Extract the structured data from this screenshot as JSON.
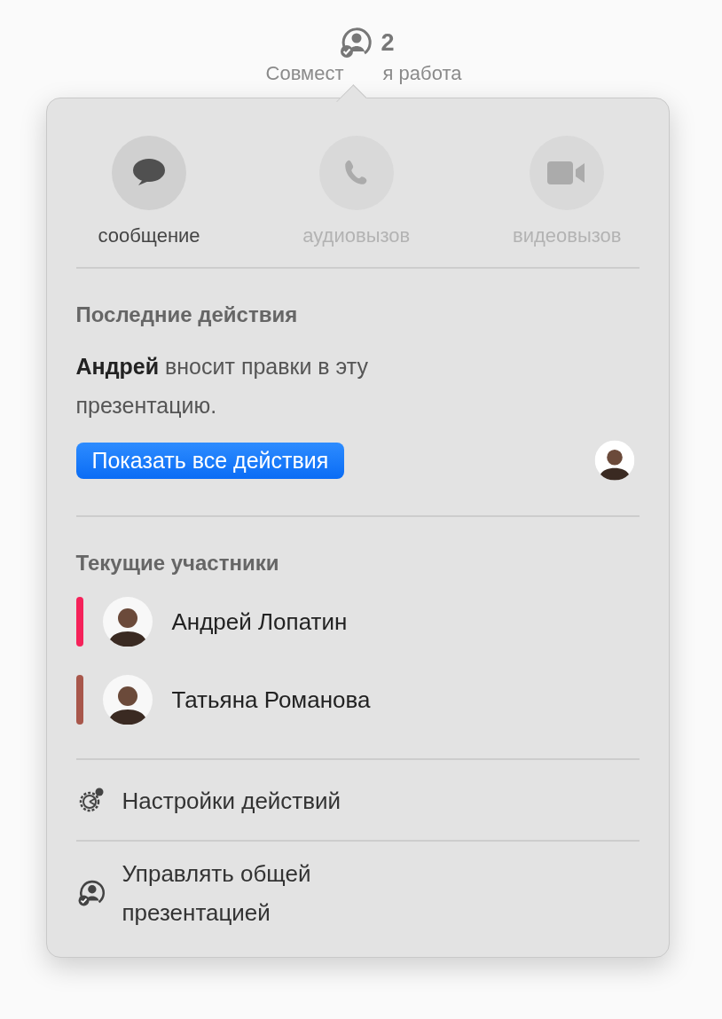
{
  "toolbar": {
    "count": "2",
    "label_parts": [
      "Совмест",
      "я работа"
    ]
  },
  "actions": [
    {
      "kind": "message",
      "label": "сообщение",
      "disabled": false
    },
    {
      "kind": "audio",
      "label": "аудиовызов",
      "disabled": true
    },
    {
      "kind": "video",
      "label": "видеовызов",
      "disabled": true
    }
  ],
  "recent": {
    "heading": "Последние действия",
    "text": "**Андрей** вносит правки в эту презентацию.",
    "button": "Показать все действия"
  },
  "participants": {
    "heading": "Текущие участники",
    "items": [
      {
        "name": "Андрей Лопатин",
        "color": "#f5225a"
      },
      {
        "name": "Татьяна Романова",
        "color": "#a8574b"
      }
    ]
  },
  "menu": [
    {
      "kind": "settings",
      "label": "Настройки действий"
    },
    {
      "kind": "manage",
      "label": "Управлять общей презентацией"
    }
  ]
}
